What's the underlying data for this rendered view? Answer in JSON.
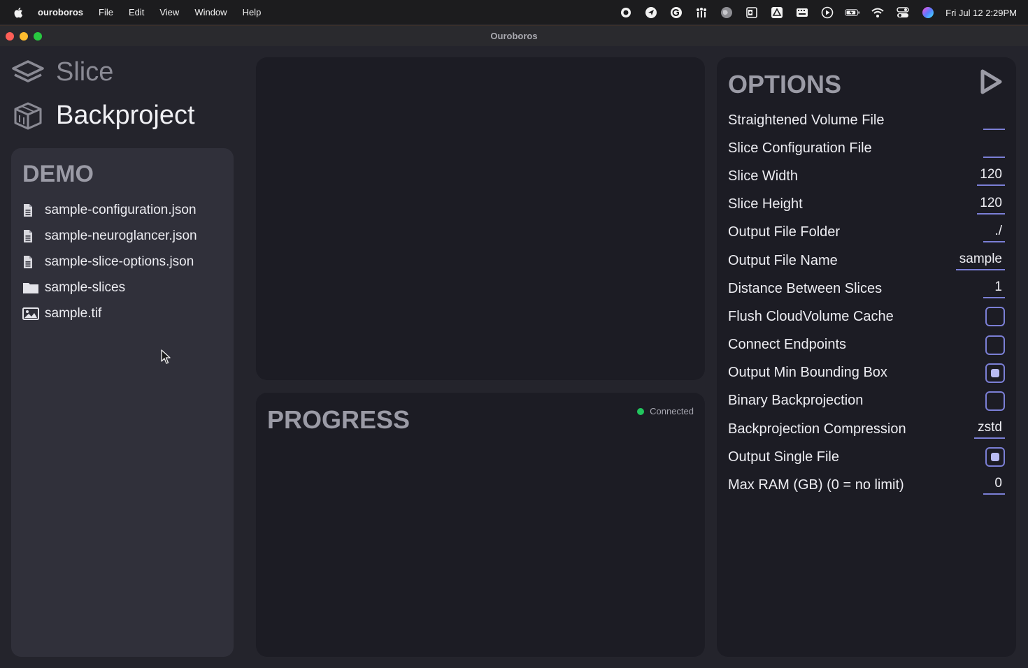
{
  "menubar": {
    "app_name": "ouroboros",
    "items": [
      "File",
      "Edit",
      "View",
      "Window",
      "Help"
    ],
    "clock": "Fri Jul 12  2:29PM"
  },
  "window": {
    "title": "Ouroboros"
  },
  "nav": {
    "slice_label": "Slice",
    "backproject_label": "Backproject"
  },
  "demo": {
    "title": "DEMO",
    "files": [
      {
        "name": "sample-configuration.json",
        "icon": "document-icon"
      },
      {
        "name": "sample-neuroglancer.json",
        "icon": "document-icon"
      },
      {
        "name": "sample-slice-options.json",
        "icon": "document-icon"
      },
      {
        "name": "sample-slices",
        "icon": "folder-icon"
      },
      {
        "name": "sample.tif",
        "icon": "image-icon"
      }
    ]
  },
  "progress": {
    "title": "PROGRESS",
    "status": "Connected",
    "status_color": "#22c55e"
  },
  "options": {
    "title": "OPTIONS",
    "rows": [
      {
        "label": "Straightened Volume File",
        "type": "text",
        "value": ""
      },
      {
        "label": "Slice Configuration File",
        "type": "text",
        "value": ""
      },
      {
        "label": "Slice Width",
        "type": "text",
        "value": "120"
      },
      {
        "label": "Slice Height",
        "type": "text",
        "value": "120"
      },
      {
        "label": "Output File Folder",
        "type": "text",
        "value": "./"
      },
      {
        "label": "Output File Name",
        "type": "text",
        "value": "sample"
      },
      {
        "label": "Distance Between Slices",
        "type": "text",
        "value": "1"
      },
      {
        "label": "Flush CloudVolume Cache",
        "type": "checkbox",
        "checked": false
      },
      {
        "label": "Connect Endpoints",
        "type": "checkbox",
        "checked": false
      },
      {
        "label": "Output Min Bounding Box",
        "type": "checkbox",
        "checked": true
      },
      {
        "label": "Binary Backprojection",
        "type": "checkbox",
        "checked": false
      },
      {
        "label": "Backprojection Compression",
        "type": "text",
        "value": "zstd"
      },
      {
        "label": "Output Single File",
        "type": "checkbox",
        "checked": true
      },
      {
        "label": "Max RAM (GB) (0 = no limit)",
        "type": "text",
        "value": "0"
      }
    ]
  },
  "colors": {
    "accent": "#7b7fd6",
    "panel": "#1c1c24",
    "sidebar_panel": "#30303a"
  }
}
